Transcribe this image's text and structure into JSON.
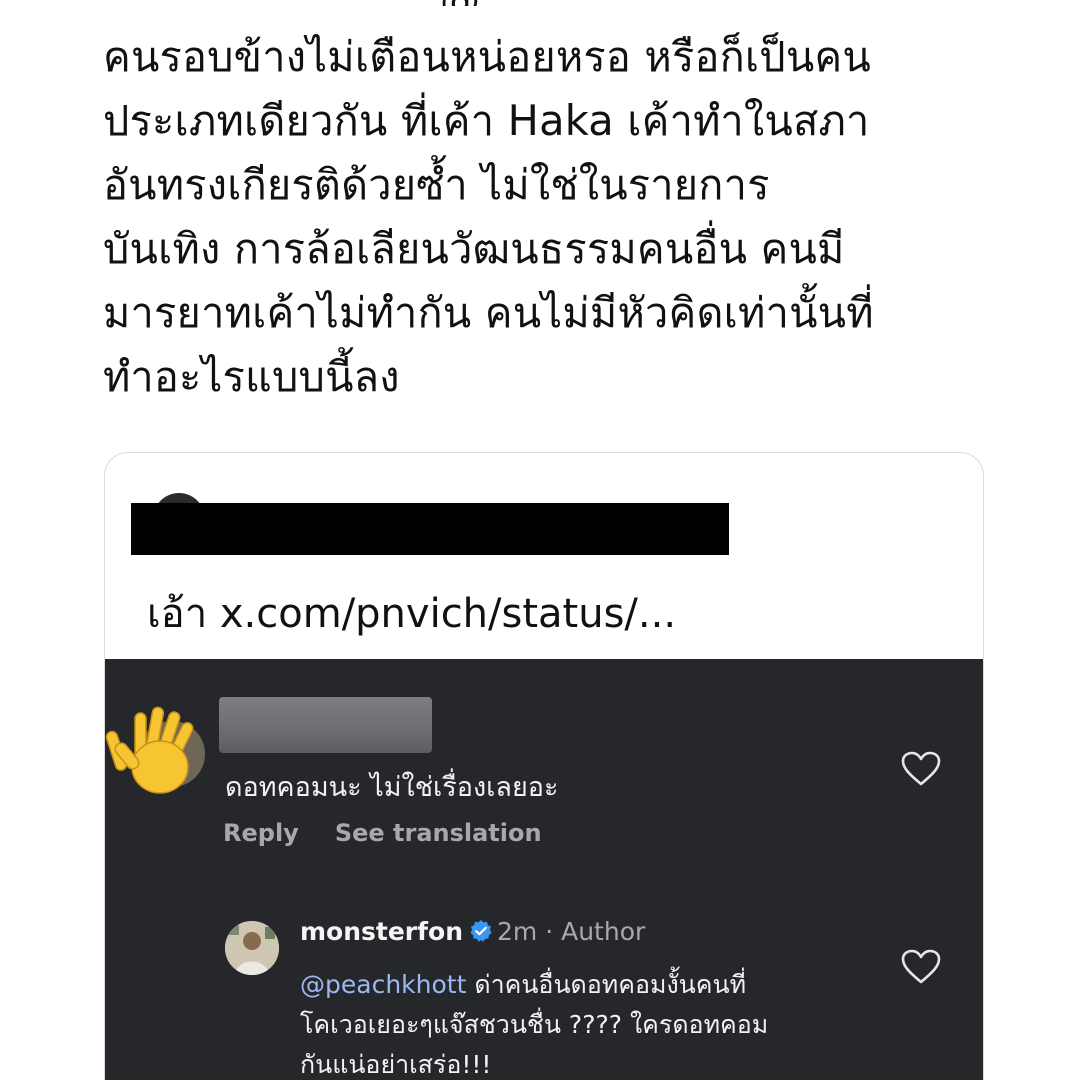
{
  "tweet": {
    "lines": [
      "คนรอบข้างไม่เตือนหน่อยหรอ หรือก็เป็นคน",
      "ประเภทเดียวกัน ที่เค้า Haka เค้าทำในสภา",
      "อันทรงเกียรติด้วยซ้ำ ไม่ใช่ในรายการ",
      "บันเทิง การล้อเลียนวัฒนธรรมคนอื่น คนมี",
      "มารยาทเค้าไม่ทำกัน คนไม่มีหัวคิดเท่านั้นที่",
      "ทำอะไรแบบนี้ลง"
    ]
  },
  "quote": {
    "text": "เอ้า x.com/pnvich/status/..."
  },
  "comment": {
    "text": "ดอทคอมนะ ไม่ใช่เรื่องเลยอะ",
    "reply_label": "Reply",
    "translation_label": "See translation"
  },
  "reply": {
    "username": "monsterfon",
    "meta": "2m · Author",
    "mention": "@peachkhott",
    "lines": [
      " ด่าคนอื่นดอทคอมงั้นคนที่",
      "โคเวอเยอะๆแจ๊สชวนชื่น ???? ใครดอทคอม",
      "กันแน่อย่าเสร่อ!!!"
    ]
  },
  "colors": {
    "dark_bg": "#25272b",
    "mention": "#9cb8f0",
    "muted": "#a8a8a8",
    "verified": "#3897f0"
  }
}
